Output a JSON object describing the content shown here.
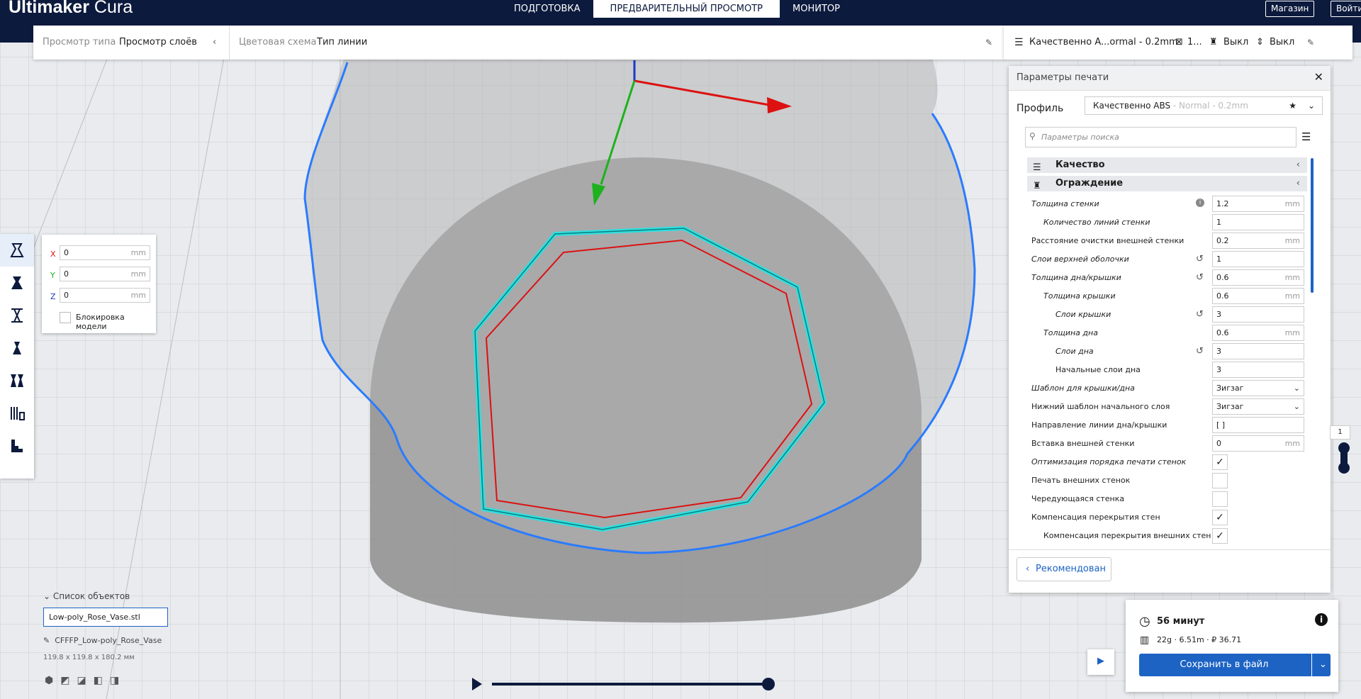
{
  "app": {
    "logo_bold": "Ultimaker",
    "logo_light": "Cura"
  },
  "stages": [
    {
      "label": "ПОДГОТОВКА"
    },
    {
      "label": "ПРЕДВАРИТЕЛЬНЫЙ ПРОСМОТР"
    },
    {
      "label": "МОНИТОР"
    }
  ],
  "header_buttons": {
    "store": "Магазин",
    "login": "Войти"
  },
  "viewbar": {
    "view_type_label": "Просмотр типа",
    "view_type_value": "Просмотр слоёв",
    "color_scheme_label": "Цветовая схема",
    "color_scheme_value": "Тип линии"
  },
  "quality_bar": {
    "profile": "Качественно A...ormal - 0.2mm",
    "infill": "1...",
    "support": "Выкл",
    "adhesion": "Выкл"
  },
  "move_panel": {
    "x_label": "X",
    "x_value": "0",
    "y_label": "Y",
    "y_value": "0",
    "z_label": "Z",
    "z_value": "0",
    "unit": "mm",
    "lock_label": "Блокировка модели"
  },
  "print_settings": {
    "title": "Параметры печати",
    "profile_label": "Профиль",
    "profile_name": "Качественно ABS",
    "profile_suffix": " - Normal - 0.2mm",
    "search_placeholder": "Параметры поиска",
    "categories": [
      {
        "label": "Качество"
      },
      {
        "label": "Ограждение"
      }
    ],
    "settings": [
      {
        "label": "Толщина стенки",
        "value": "1.2",
        "unit": "mm"
      },
      {
        "label": "Количество линий стенки",
        "value": "1",
        "unit": ""
      },
      {
        "label": "Расстояние очистки внешней стенки",
        "value": "0.2",
        "unit": "mm"
      },
      {
        "label": "Слои верхней оболочки",
        "value": "1",
        "unit": ""
      },
      {
        "label": "Толщина дна/крышки",
        "value": "0.6",
        "unit": "mm"
      },
      {
        "label": "Толщина крышки",
        "value": "0.6",
        "unit": "mm"
      },
      {
        "label": "Слои крышки",
        "value": "3",
        "unit": ""
      },
      {
        "label": "Толщина дна",
        "value": "0.6",
        "unit": "mm"
      },
      {
        "label": "Слои дна",
        "value": "3",
        "unit": ""
      },
      {
        "label": "Начальные слои дна",
        "value": "3",
        "unit": ""
      },
      {
        "label": "Шаблон для крышки/дна",
        "value": "Зигзаг",
        "unit": ""
      },
      {
        "label": "Нижний шаблон начального слоя",
        "value": "Зигзаг",
        "unit": ""
      },
      {
        "label": "Направление линии дна/крышки",
        "value": "[ ]",
        "unit": ""
      },
      {
        "label": "Вставка внешней стенки",
        "value": "0",
        "unit": "mm"
      },
      {
        "label": "Оптимизация порядка печати стенок",
        "checked": true
      },
      {
        "label": "Печать внешних стенок",
        "checked": false
      },
      {
        "label": "Чередующаяся стенка",
        "checked": false
      },
      {
        "label": "Компенсация перекрытия стен",
        "checked": true
      },
      {
        "label": "Компенсация перекрытия внешних стен",
        "checked": true
      }
    ],
    "recommended_label": "Рекомендован"
  },
  "estimate": {
    "time": "56 минут",
    "material": "22g · 6.51m · ₽ 36.71",
    "save_label": "Сохранить в файл"
  },
  "objects": {
    "header": "Список объектов",
    "file": "Low-poly_Rose_Vase.stl",
    "job_name": "CFFFP_Low-poly_Rose_Vase",
    "dimensions": "119.8 x 119.8 x 180.2 мм"
  },
  "layer_slider": {
    "value": "1"
  },
  "colors": {
    "header": "#0c1a3d",
    "accent": "#1c63c4",
    "wall_outer": "#2a7bff",
    "inner_wall": "#d11",
    "outer_wall": "#2ee0e0"
  }
}
